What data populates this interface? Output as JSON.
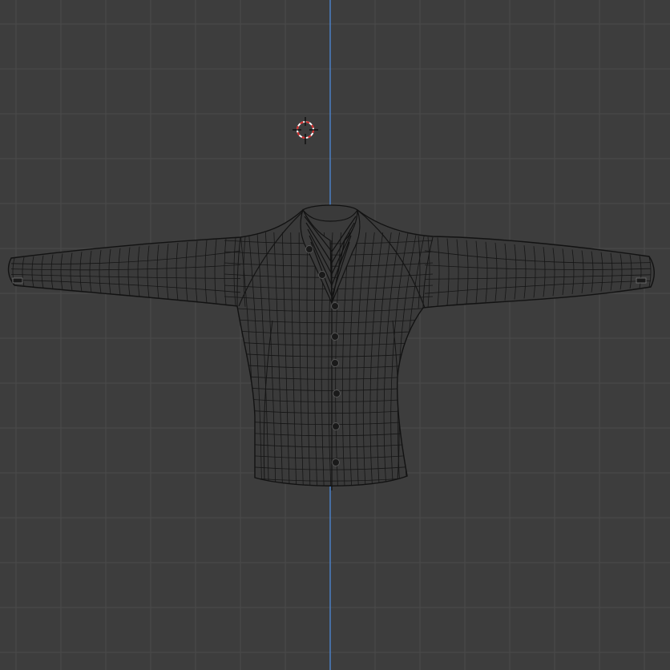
{
  "viewport": {
    "background": "#3d3d3d",
    "grid_color": "#4a4a4a",
    "axis_color": "#4b7fc4",
    "mesh_line_color": "#151515",
    "mesh_fill_color": "#3a3a3a",
    "cursor_colors": [
      "#d62828",
      "#ffffff"
    ]
  },
  "scene": {
    "object": "shirt-mesh",
    "shading": "wireframe",
    "button_count": 8,
    "cursor_icon": "3d-cursor-icon"
  }
}
